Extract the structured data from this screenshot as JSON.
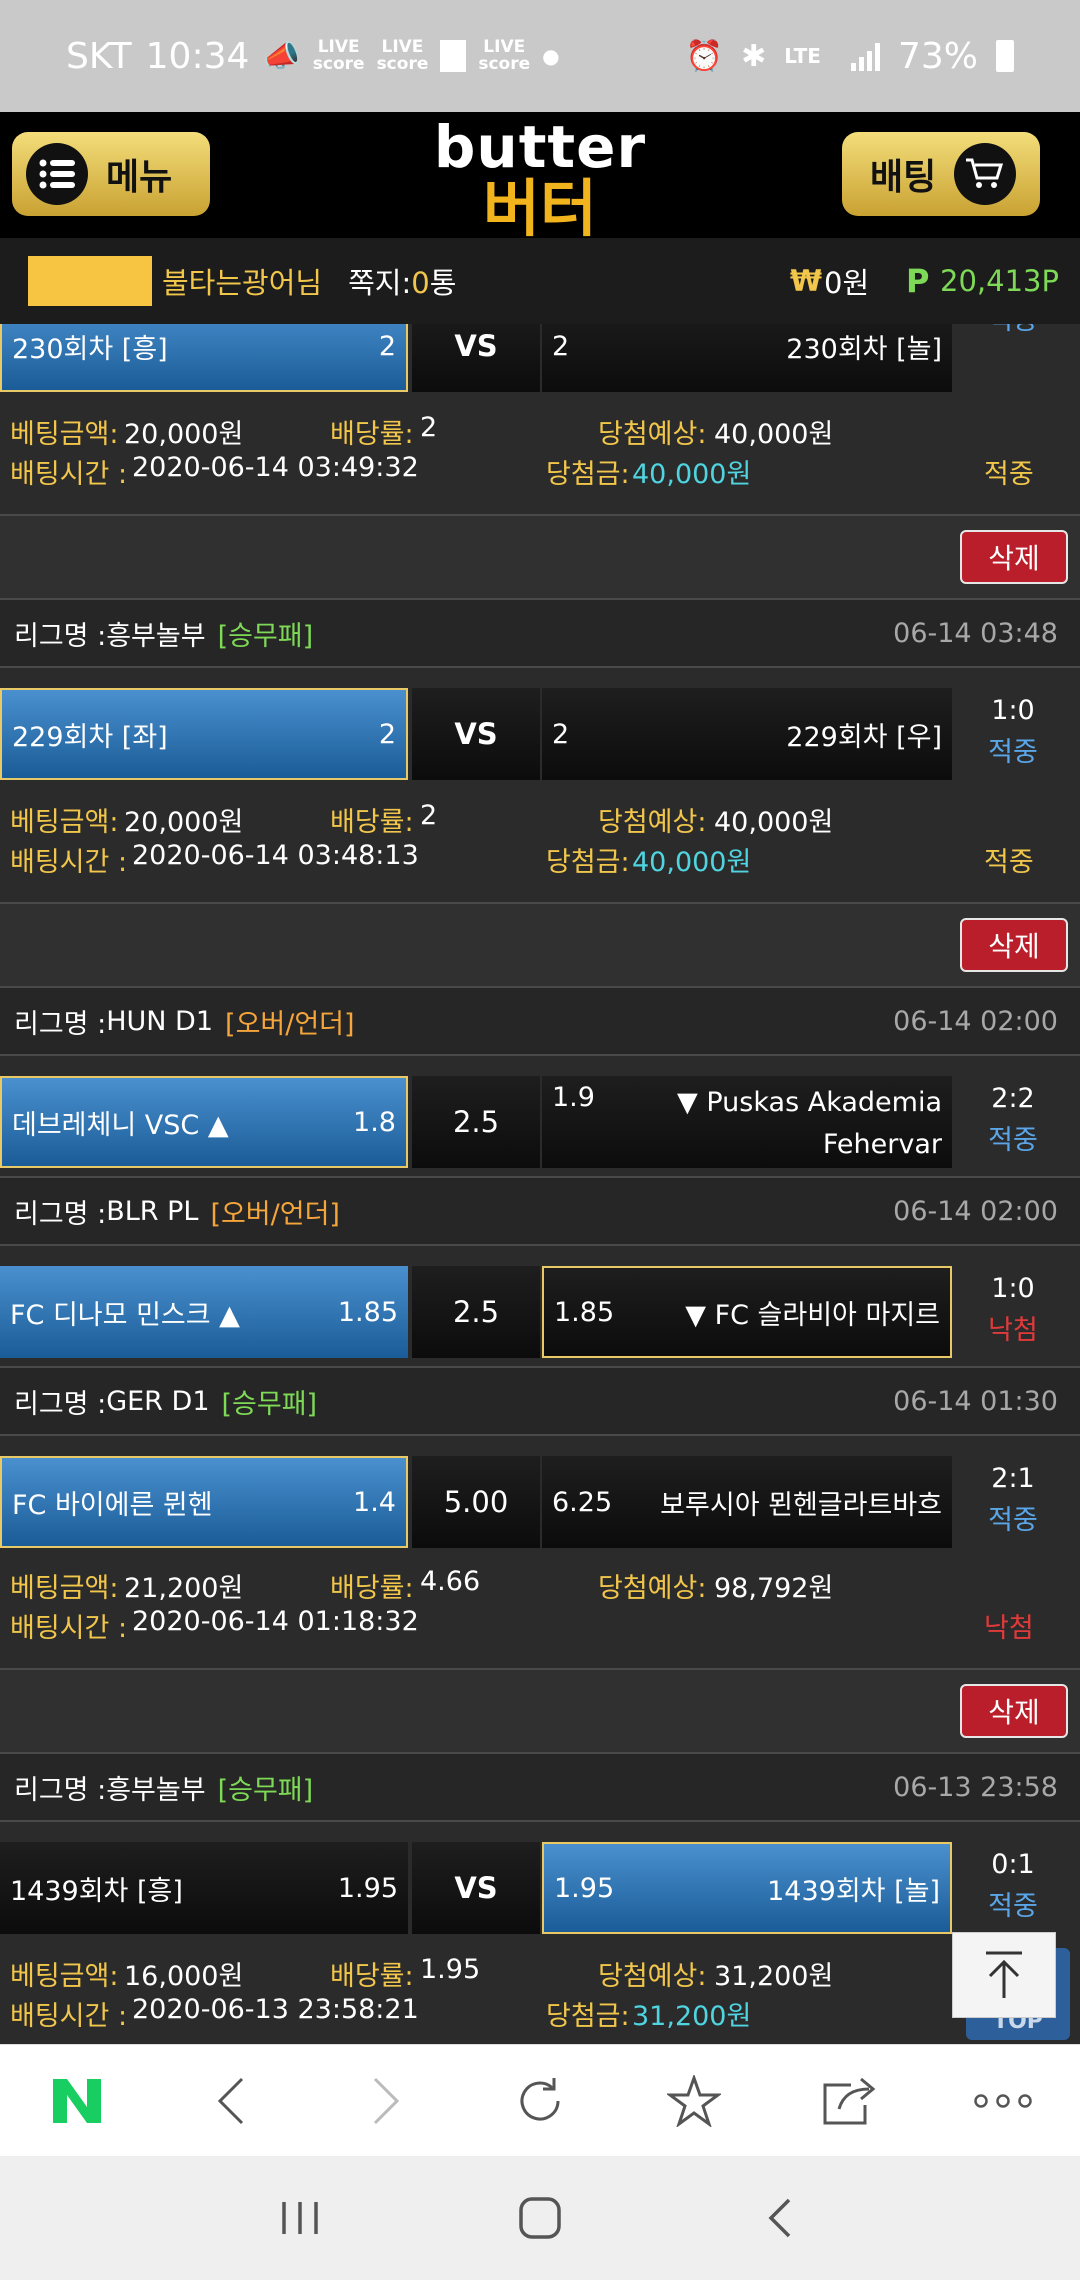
{
  "status_bar": {
    "carrier": "SKT",
    "time": "10:34",
    "live_label": "LIVE",
    "score_label": "score",
    "network": "LTE",
    "battery": "73%"
  },
  "header": {
    "menu_label": "메뉴",
    "logo_en": "butter",
    "logo_ko": "버터",
    "bet_label": "배팅"
  },
  "user": {
    "suffix": "불타는광어님",
    "notes_label": "쪽지:",
    "notes_count": "0",
    "notes_unit": "통",
    "won_symbol": "₩",
    "money": "0원",
    "point_symbol": "P",
    "points": "20,413P"
  },
  "labels": {
    "league": "리그명 : ",
    "bet_amount": "베팅금액:",
    "odds": "배당률:",
    "expected": "당첨예상:",
    "bet_time": "배팅시간 : ",
    "win_amount": "당첨금:",
    "delete": "삭제",
    "vs": "VS",
    "hit": "적중",
    "miss": "낙첨"
  },
  "bets": [
    {
      "match": {
        "home": "230회차 [흥]",
        "home_odds": "2",
        "mid": "VS",
        "away_odds": "2",
        "away": "230회차 [놀]",
        "score": "",
        "result": "적중"
      },
      "amount": "20,000원",
      "odds": "2",
      "expected": "40,000원",
      "time": "2020-06-14 03:49:32",
      "win": "40,000원",
      "status": "적중"
    },
    {
      "league": "흥부놀부",
      "type": "[승무패]",
      "date": "06-14 03:48",
      "match": {
        "home": "229회차 [좌]",
        "home_odds": "2",
        "mid": "VS",
        "away_odds": "2",
        "away": "229회차 [우]",
        "score": "1:0",
        "result": "적중"
      },
      "amount": "20,000원",
      "odds": "2",
      "expected": "40,000원",
      "time": "2020-06-14 03:48:13",
      "win": "40,000원",
      "status": "적중"
    },
    {
      "games": [
        {
          "league": "HUN D1",
          "type": "[오버/언더]",
          "date": "06-14 02:00",
          "home": "데브레체니 VSC ▲",
          "home_odds": "1.8",
          "mid": "2.5",
          "away_odds": "1.9",
          "away_l1": "▼ Puskas Akademia",
          "away_l2": "Fehervar",
          "score": "2:2",
          "result": "적중"
        },
        {
          "league": "BLR PL",
          "type": "[오버/언더]",
          "date": "06-14 02:00",
          "home": "FC 디나모 민스크 ▲",
          "home_odds": "1.85",
          "mid": "2.5",
          "away_odds": "1.85",
          "away": "▼ FC 슬라비아 마지르",
          "score": "1:0",
          "result": "낙첨"
        },
        {
          "league": "GER D1",
          "type": "[승무패]",
          "date": "06-14 01:30",
          "home": "FC 바이에른 뮌헨",
          "home_odds": "1.4",
          "mid": "5.00",
          "away_odds": "6.25",
          "away": "보루시아 묀헨글라트바흐",
          "score": "2:1",
          "result": "적중"
        }
      ],
      "amount": "21,200원",
      "odds": "4.66",
      "expected": "98,792원",
      "time": "2020-06-14 01:18:32",
      "status": "낙첨"
    },
    {
      "league": "흥부놀부",
      "type": "[승무패]",
      "date": "06-13 23:58",
      "match": {
        "home": "1439회차 [흥]",
        "home_odds": "1.95",
        "mid": "VS",
        "away_odds": "1.95",
        "away": "1439회차 [놀]",
        "score": "0:1",
        "result": "적중"
      },
      "amount": "16,000원",
      "odds": "1.95",
      "expected": "31,200원",
      "time": "2020-06-13 23:58:21",
      "win": "31,200원"
    }
  ],
  "scroll_top_label": "TOP",
  "colors": {
    "accent_gold": "#f1c64b",
    "win_cyan": "#4fd4e0",
    "lose_red": "#e23a3a",
    "naver_green": "#19ce60"
  }
}
